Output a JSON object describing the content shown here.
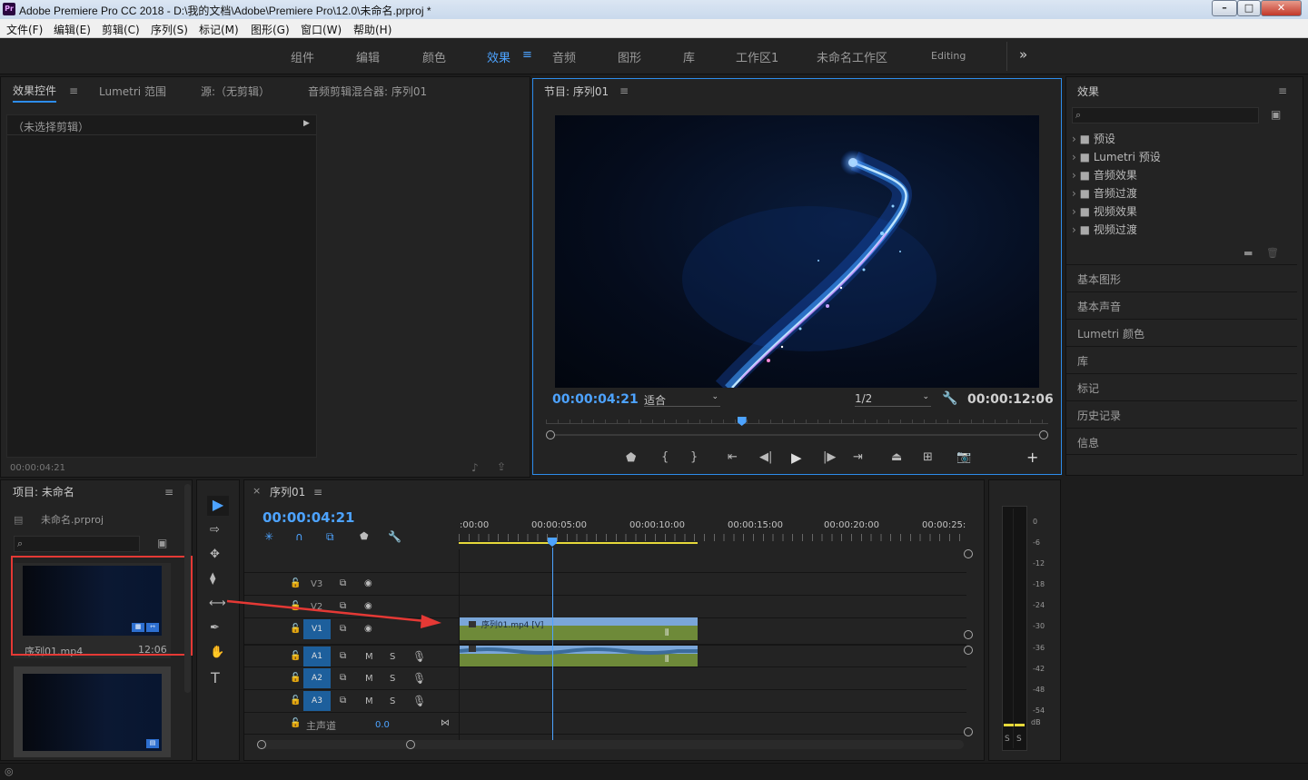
{
  "window": {
    "title": "Adobe Premiere Pro CC 2018 - D:\\我的文档\\Adobe\\Premiere Pro\\12.0\\未命名.prproj *",
    "app_icon": "Pr",
    "controls": [
      "–",
      "□",
      "✕"
    ]
  },
  "menu": [
    "文件(F)",
    "编辑(E)",
    "剪辑(C)",
    "序列(S)",
    "标记(M)",
    "图形(G)",
    "窗口(W)",
    "帮助(H)"
  ],
  "workspaces": {
    "items": [
      "组件",
      "编辑",
      "颜色",
      "效果",
      "音频",
      "图形",
      "库",
      "工作区1",
      "未命名工作区",
      "Editing"
    ],
    "active": "效果",
    "overflow": "»"
  },
  "source_panel": {
    "tabs": [
      "效果控件",
      "Lumetri 范围",
      "源:（无剪辑）",
      "音频剪辑混合器: 序列01"
    ],
    "menu_glyph": "≡",
    "no_clip": "（未选择剪辑）",
    "timecode": "00:00:04:21"
  },
  "program": {
    "title": "节目: 序列01",
    "timecode": "00:00:04:21",
    "fit": "适合",
    "resolution": "1/2",
    "duration": "00:00:12:06",
    "playhead_fraction": 0.39,
    "transport": [
      "marker-icon",
      "in-point-icon",
      "out-point-icon",
      "go-to-in-icon",
      "step-back-icon",
      "play-icon",
      "step-forward-icon",
      "go-to-out-icon",
      "lift-icon",
      "extract-icon",
      "export-frame-icon",
      "add-button-icon"
    ]
  },
  "effects": {
    "title": "效果",
    "search_placeholder": "",
    "tree": [
      "预设",
      "Lumetri 预设",
      "音频效果",
      "音频过渡",
      "视频效果",
      "视频过渡"
    ],
    "sections": [
      "基本图形",
      "基本声音",
      "Lumetri 颜色",
      "库",
      "标记",
      "历史记录",
      "信息"
    ]
  },
  "project": {
    "title": "项目: 未命名",
    "file": "未命名.prproj",
    "items": [
      {
        "name": "序列01.mp4",
        "duration": "12:06"
      },
      {
        "name": "",
        "duration": ""
      }
    ]
  },
  "timeline": {
    "tab": "序列01",
    "timecode": "00:00:04:21",
    "ruler": [
      ":00:00",
      "00:00:05:00",
      "00:00:10:00",
      "00:00:15:00",
      "00:00:20:00",
      "00:00:25:"
    ],
    "video_tracks": [
      "V3",
      "V2",
      "V1"
    ],
    "audio_tracks": [
      "A1",
      "A2",
      "A3"
    ],
    "master": {
      "label": "主声道",
      "value": "0.0"
    },
    "clip_label": "序列01.mp4 [V]",
    "audio_buttons": {
      "mute": "M",
      "solo": "S"
    }
  },
  "meter": {
    "scale": [
      "0",
      "-6",
      "-12",
      "-18",
      "-24",
      "-30",
      "-36",
      "-42",
      "-48",
      "-54",
      "dB"
    ],
    "solo_labels": [
      "S",
      "S"
    ]
  },
  "colors": {
    "accent": "#2d8ceb",
    "timecode": "#4da3ff",
    "video_clip": "#7aa6d9",
    "audio_clip": "#6e8a39",
    "annotation": "#e53935"
  }
}
